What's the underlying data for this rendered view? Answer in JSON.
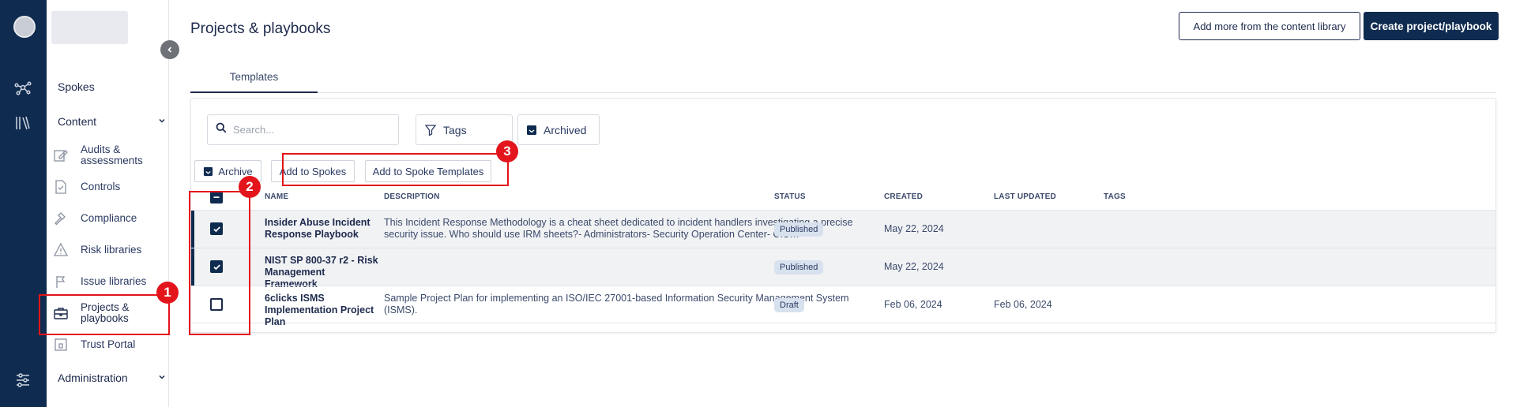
{
  "sidebar": {
    "spokes": "Spokes",
    "content": "Content",
    "items": [
      {
        "label": "Audits & assessments",
        "icon": "edit-icon"
      },
      {
        "label": "Controls",
        "icon": "document-check-icon"
      },
      {
        "label": "Compliance",
        "icon": "gavel-icon"
      },
      {
        "label": "Risk libraries",
        "icon": "warning-icon"
      },
      {
        "label": "Issue libraries",
        "icon": "flag-icon"
      },
      {
        "label": "Projects & playbooks",
        "icon": "briefcase-icon"
      },
      {
        "label": "Trust Portal",
        "icon": "portal-icon"
      }
    ],
    "administration": "Administration"
  },
  "header": {
    "title": "Projects & playbooks",
    "add_more_label": "Add more from the content library",
    "create_label": "Create project/playbook"
  },
  "tabs": [
    {
      "label": "Templates"
    }
  ],
  "toolbar": {
    "search_placeholder": "Search...",
    "tags_label": "Tags",
    "archived_label": "Archived"
  },
  "actions": {
    "archive_label": "Archive",
    "add_to_spokes_label": "Add to Spokes",
    "add_to_spoke_templates_label": "Add to Spoke Templates"
  },
  "table": {
    "columns": [
      "NAME",
      "DESCRIPTION",
      "STATUS",
      "CREATED",
      "LAST UPDATED",
      "TAGS"
    ],
    "rows": [
      {
        "checked": true,
        "name": "Insider Abuse Incident Response Playbook",
        "description": "This Incident Response Methodology is a cheat sheet dedicated to incident handlers investigating a precise security issue. Who should use IRM sheets?- Administrators- Security Operation Center- CIS…",
        "status": "Published",
        "created": "May 22, 2024",
        "last_updated": ""
      },
      {
        "checked": true,
        "name": "NIST SP 800-37 r2 - Risk Management Framework",
        "description": "",
        "status": "Published",
        "created": "May 22, 2024",
        "last_updated": ""
      },
      {
        "checked": false,
        "name": "6clicks ISMS Implementation Project Plan",
        "description": "Sample Project Plan for implementing an ISO/IEC 27001-based Information Security Management System (ISMS).",
        "status": "Draft",
        "created": "Feb 06, 2024",
        "last_updated": "Feb 06, 2024"
      }
    ]
  },
  "annotations": [
    "1",
    "2",
    "3"
  ],
  "colors": {
    "navy": "#0f2b4f",
    "annotation_red": "#e3141b",
    "badge_bg": "#d8e1ee"
  }
}
